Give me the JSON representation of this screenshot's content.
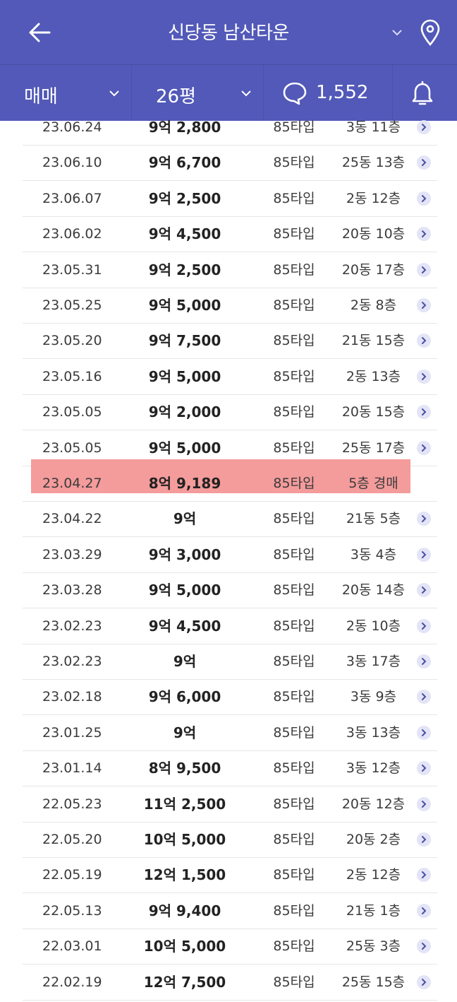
{
  "header": {
    "title": "신당동 남산타운",
    "back_icon": "arrow-left-icon",
    "dropdown_icon": "chevron-down-icon",
    "location_icon": "map-pin-icon",
    "background": "#5259b8"
  },
  "filters": {
    "trade_type": "매매",
    "area": "26평",
    "comment_count": "1,552",
    "comment_icon": "speech-bubble-icon",
    "alarm_icon": "bell-icon"
  },
  "transactions": [
    {
      "date": "23.06.24",
      "price": "9억 2,800",
      "type": "85타입",
      "location": "3동 11층"
    },
    {
      "date": "23.06.10",
      "price": "9억 6,700",
      "type": "85타입",
      "location": "25동 13층"
    },
    {
      "date": "23.06.07",
      "price": "9억 2,500",
      "type": "85타입",
      "location": "2동 12층"
    },
    {
      "date": "23.06.02",
      "price": "9억 4,500",
      "type": "85타입",
      "location": "20동 10층"
    },
    {
      "date": "23.05.31",
      "price": "9억 2,500",
      "type": "85타입",
      "location": "20동 17층"
    },
    {
      "date": "23.05.25",
      "price": "9억 5,000",
      "type": "85타입",
      "location": "2동 8층"
    },
    {
      "date": "23.05.20",
      "price": "9억 7,500",
      "type": "85타입",
      "location": "21동 15층"
    },
    {
      "date": "23.05.16",
      "price": "9억 5,000",
      "type": "85타입",
      "location": "2동 13층"
    },
    {
      "date": "23.05.05",
      "price": "9억 2,000",
      "type": "85타입",
      "location": "20동 15층"
    },
    {
      "date": "23.05.05",
      "price": "9억 5,000",
      "type": "85타입",
      "location": "25동 17층"
    },
    {
      "date": "23.04.27",
      "price": "8억 9,189",
      "type": "85타입",
      "location": "5층 경매",
      "highlighted": true,
      "highlight_color": "#f49b9b"
    },
    {
      "date": "23.04.22",
      "price": "9억",
      "type": "85타입",
      "location": "21동 5층"
    },
    {
      "date": "23.03.29",
      "price": "9억 3,000",
      "type": "85타입",
      "location": "3동 4층"
    },
    {
      "date": "23.03.28",
      "price": "9억 5,000",
      "type": "85타입",
      "location": "20동 14층"
    },
    {
      "date": "23.02.23",
      "price": "9억 4,500",
      "type": "85타입",
      "location": "2동 10층"
    },
    {
      "date": "23.02.23",
      "price": "9억",
      "type": "85타입",
      "location": "3동 17층"
    },
    {
      "date": "23.02.18",
      "price": "9억 6,000",
      "type": "85타입",
      "location": "3동 9층"
    },
    {
      "date": "23.01.25",
      "price": "9억",
      "type": "85타입",
      "location": "3동 13층"
    },
    {
      "date": "23.01.14",
      "price": "8억 9,500",
      "type": "85타입",
      "location": "3동 12층"
    },
    {
      "date": "22.05.23",
      "price": "11억 2,500",
      "type": "85타입",
      "location": "20동 12층"
    },
    {
      "date": "22.05.20",
      "price": "10억 5,000",
      "type": "85타입",
      "location": "20동 2층"
    },
    {
      "date": "22.05.19",
      "price": "12억 1,500",
      "type": "85타입",
      "location": "2동 12층"
    },
    {
      "date": "22.05.13",
      "price": "9억 9,400",
      "type": "85타입",
      "location": "21동 1층"
    },
    {
      "date": "22.03.01",
      "price": "10억 5,000",
      "type": "85타입",
      "location": "25동 3층"
    },
    {
      "date": "22.02.19",
      "price": "12억 7,500",
      "type": "85타입",
      "location": "25동 15층"
    }
  ],
  "row_arrow_icon": "chevron-right-icon"
}
